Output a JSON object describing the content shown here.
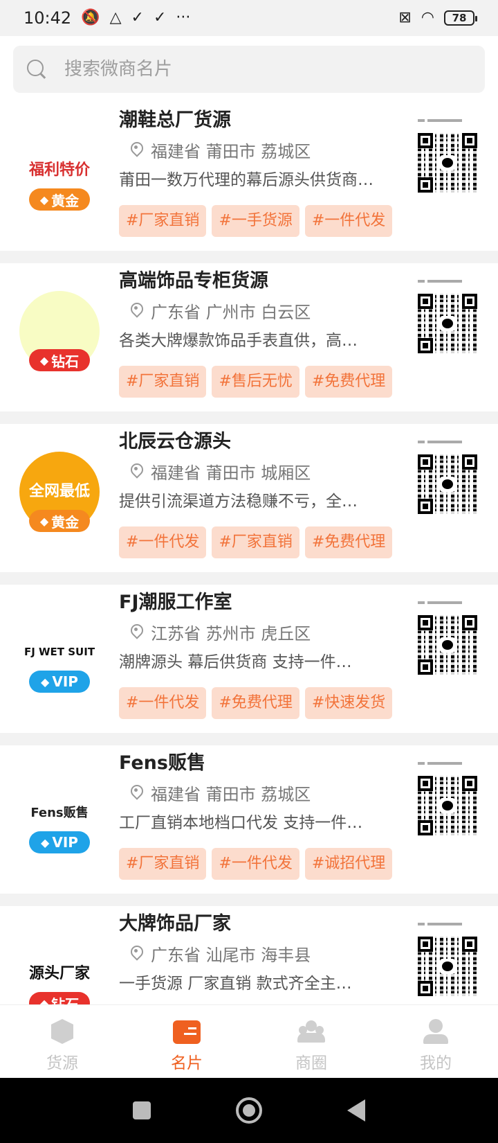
{
  "status_bar": {
    "time": "10:42",
    "battery": "78"
  },
  "search": {
    "placeholder": "搜索微商名片"
  },
  "cards": [
    {
      "name": "潮鞋总厂货源",
      "location": "福建省 莆田市 荔城区",
      "description": "莆田一数万代理的幕后源头供货商…",
      "tags": [
        "#厂家直销",
        "#一手货源",
        "#一件代发"
      ],
      "badge": "黄金",
      "badge_type": "gold",
      "avatar_text": "福利特价",
      "avatar_bg": "#ffffff",
      "avatar_color": "#d83030"
    },
    {
      "name": "高端饰品专柜货源",
      "location": "广东省 广州市 白云区",
      "description": "各类大牌爆款饰品手表直供，高…",
      "tags": [
        "#厂家直销",
        "#售后无忧",
        "#免费代理"
      ],
      "badge": "钻石",
      "badge_type": "diamond",
      "avatar_text": "",
      "avatar_bg": "#f8fcc4",
      "avatar_color": "#c0282a"
    },
    {
      "name": "北辰云仓源头",
      "location": "福建省 莆田市 城厢区",
      "description": "提供引流渠道方法稳赚不亏，全…",
      "tags": [
        "#一件代发",
        "#厂家直销",
        "#免费代理"
      ],
      "badge": "黄金",
      "badge_type": "gold",
      "avatar_text": "全网最低",
      "avatar_bg": "#f7a70f",
      "avatar_color": "#ffffff"
    },
    {
      "name": "FJ潮服工作室",
      "location": "江苏省 苏州市 虎丘区",
      "description": "潮牌源头 幕后供货商 支持一件…",
      "tags": [
        "#一件代发",
        "#免费代理",
        "#快速发货"
      ],
      "badge": "VIP",
      "badge_type": "vip",
      "avatar_text": "FJ WET SUIT",
      "avatar_bg": "#ffffff",
      "avatar_color": "#111111"
    },
    {
      "name": "Fens贩售",
      "location": "福建省 莆田市 荔城区",
      "description": "工厂直销本地档口代发 支持一件…",
      "tags": [
        "#厂家直销",
        "#一件代发",
        "#诚招代理"
      ],
      "badge": "VIP",
      "badge_type": "vip",
      "avatar_text": "Fens贩售",
      "avatar_bg": "#ffffff",
      "avatar_color": "#222222"
    },
    {
      "name": "大牌饰品厂家",
      "location": "广东省 汕尾市 海丰县",
      "description": "一手货源 厂家直销 款式齐全主…",
      "tags": [],
      "badge": "钻石",
      "badge_type": "diamond",
      "avatar_text": "源头厂家",
      "avatar_bg": "#ffffff",
      "avatar_color": "#111111"
    }
  ],
  "tabbar": {
    "tabs": [
      {
        "label": "货源",
        "icon": "box-icon"
      },
      {
        "label": "名片",
        "icon": "card-icon"
      },
      {
        "label": "商圈",
        "icon": "group-icon"
      },
      {
        "label": "我的",
        "icon": "me-icon"
      }
    ],
    "active": 1
  },
  "colors": {
    "accent": "#ef6020",
    "tag_bg": "#fcdccd",
    "tag_text": "#f2733a"
  }
}
